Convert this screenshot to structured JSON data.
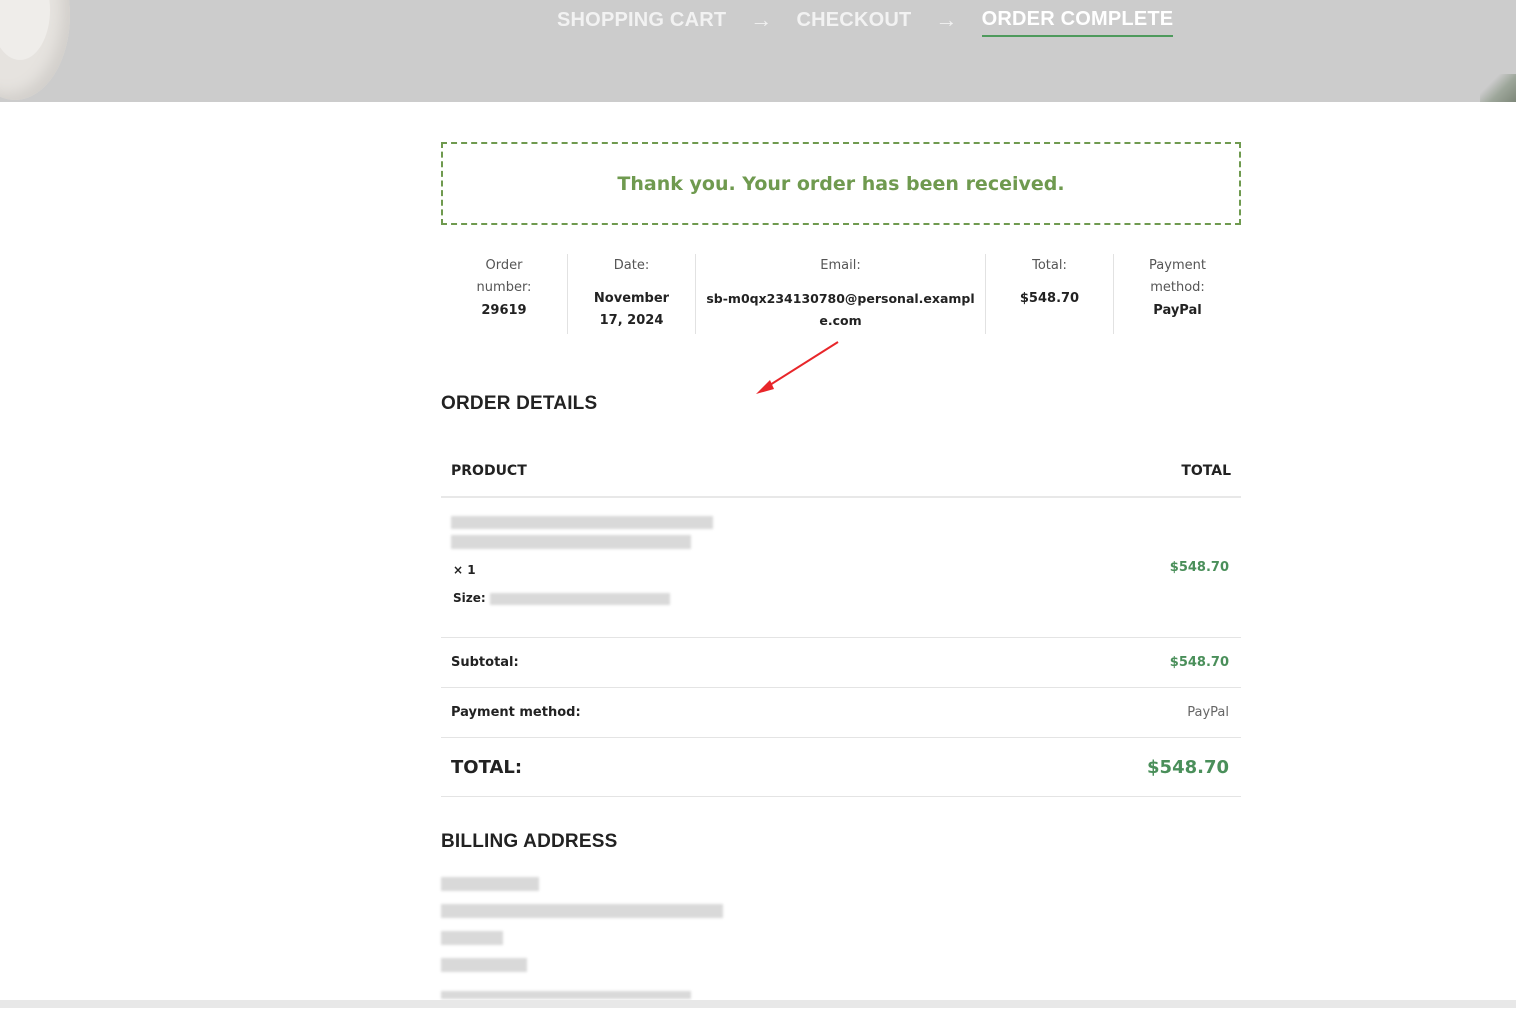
{
  "steps": {
    "cart": "SHOPPING CART",
    "checkout": "CHECKOUT",
    "complete": "ORDER COMPLETE",
    "arrow": "→"
  },
  "notice": "Thank you. Your order has been received.",
  "overview": {
    "order_label": "Order number:",
    "order_value": "29619",
    "date_label": "Date:",
    "date_value": "November 17, 2024",
    "email_label": "Email:",
    "email_value": "sb-m0qx234130780@personal.example.com",
    "total_label": "Total:",
    "total_value": "$548.70",
    "payment_label": "Payment method:",
    "payment_value": "PayPal"
  },
  "order_details": {
    "title": "ORDER DETAILS",
    "col_product": "PRODUCT",
    "col_total": "TOTAL",
    "item": {
      "qty": "× 1",
      "size_label": "Size:",
      "price": "$548.70"
    },
    "subtotal_label": "Subtotal:",
    "subtotal_value": "$548.70",
    "payment_label": "Payment method:",
    "payment_value": "PayPal",
    "total_label": "TOTAL:",
    "total_value": "$548.70"
  },
  "billing": {
    "title": "BILLING ADDRESS"
  },
  "colors": {
    "accent_green": "#4a8f5a",
    "notice_green": "#6f9a4f",
    "annotation_red": "#e8262a"
  }
}
